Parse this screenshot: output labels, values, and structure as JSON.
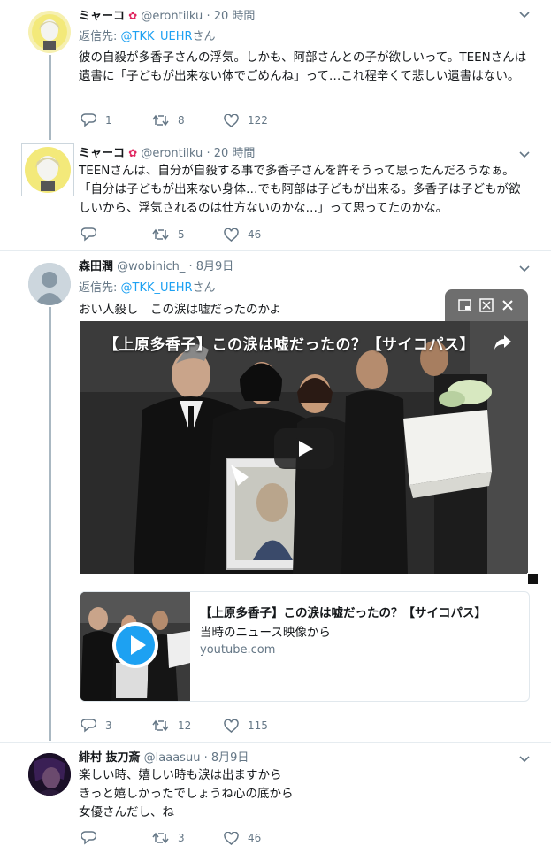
{
  "tweets": [
    {
      "name": "ミャーコ",
      "handle": "@erontilku",
      "time": "· 20 時間",
      "reply_prefix": "返信先: ",
      "reply_to": "@TKK_UEHR",
      "reply_suffix": "さん",
      "text": "彼の自殺が多香子さんの浮気。しかも、阿部さんとの子が欲しいって。TEENさんは遺書に「子どもが出来ない体でごめんね」って…これ程辛くて悲しい遺書はない。",
      "replies": "1",
      "retweets": "8",
      "likes": "122"
    },
    {
      "name": "ミャーコ",
      "handle": "@erontilku",
      "time": "· 20 時間",
      "text": "TEENさんは、自分が自殺する事で多香子さんを許そうって思ったんだろうなぁ。「自分は子どもが出来ない身体…でも阿部は子どもが出来る。多香子は子どもが欲しいから、浮気されるのは仕方ないのかな…」って思ってたのかな。",
      "replies": "",
      "retweets": "5",
      "likes": "46"
    },
    {
      "name": "森田潤",
      "handle": "@wobinich_",
      "time": "· 8月9日",
      "reply_prefix": "返信先: ",
      "reply_to": "@TKK_UEHR",
      "reply_suffix": "さん",
      "text": "おい人殺し　この涙は嘘だったのかよ",
      "video_title": "【上原多香子】この涙は嘘だったの？【サイコパス】",
      "card_title": "【上原多香子】この涙は嘘だったの？【サイコパス】",
      "card_desc": "当時のニュース映像から",
      "card_domain": "youtube.com",
      "replies": "3",
      "retweets": "12",
      "likes": "115"
    },
    {
      "name": "緋村 抜刀斎",
      "handle": "@laaasuu",
      "time": "· 8月9日",
      "text_lines": [
        "楽しい時、嬉しい時も涙は出ますから",
        "きっと嬉しかったでしょうね心の底から",
        "女優さんだし、ね"
      ],
      "replies": "",
      "retweets": "3",
      "likes": "46"
    }
  ],
  "icons": {
    "reply": "reply-icon",
    "retweet": "retweet-icon",
    "like": "heart-icon",
    "more": "chevron-down-icon",
    "play": "play-icon",
    "share": "share-arrow-icon",
    "minimize": "minimize-icon",
    "fullscreen": "fullscreen-icon",
    "close": "close-icon"
  },
  "colors": {
    "link": "#1da1f2",
    "muted": "#657786",
    "thread_line": "#aab8c2"
  }
}
